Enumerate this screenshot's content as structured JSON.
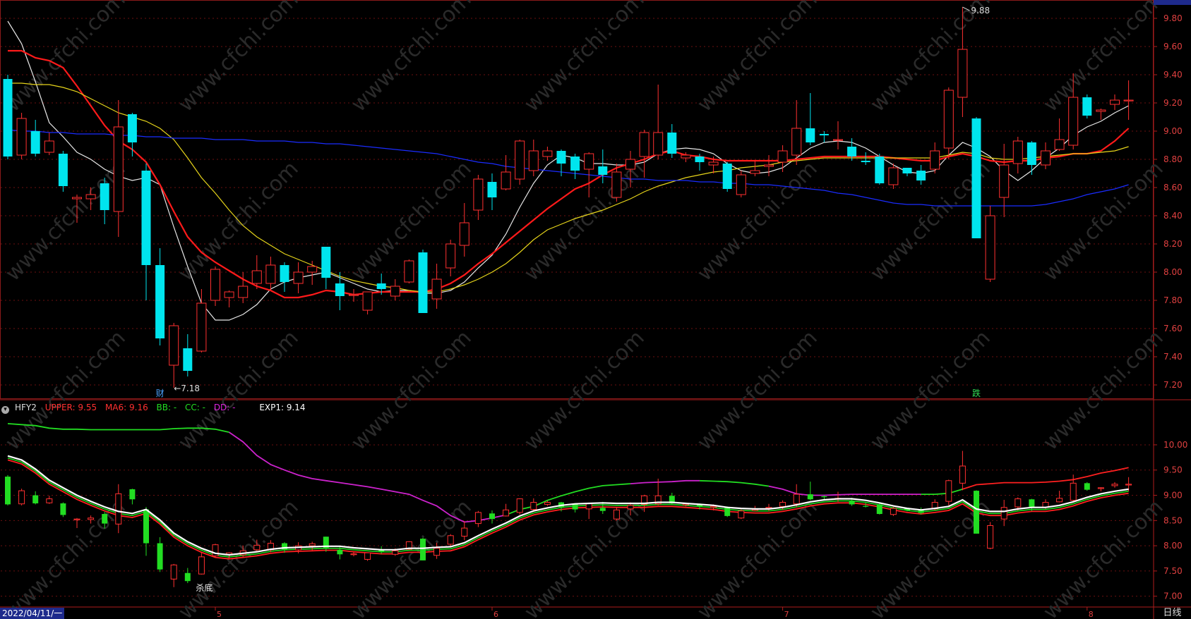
{
  "chart_data": {
    "type": "candlestick",
    "date_label": "2022/04/11/一",
    "period": "日线",
    "month_ticks": [
      "5",
      "6",
      "7",
      "8"
    ],
    "main": {
      "yticks": [
        "9.80",
        "9.60",
        "9.40",
        "9.20",
        "9.00",
        "8.80",
        "8.60",
        "8.40",
        "8.20",
        "8.00",
        "7.80",
        "7.60",
        "7.40",
        "7.20"
      ],
      "ylim": [
        7.1,
        9.9
      ],
      "high_annotation": "9.88",
      "low_annotation": "7.18",
      "markers": [
        {
          "text": "财",
          "color": "#4aa3ff"
        },
        {
          "text": "跌",
          "color": "#33dd55"
        }
      ],
      "candles": [
        [
          9.37,
          8.82,
          9.4,
          8.8
        ],
        [
          8.83,
          9.09,
          9.13,
          8.8
        ],
        [
          9.0,
          8.84,
          9.08,
          8.82
        ],
        [
          8.85,
          8.93,
          8.99,
          8.83
        ],
        [
          8.84,
          8.61,
          8.86,
          8.57
        ],
        [
          8.52,
          8.53,
          8.55,
          8.35
        ],
        [
          8.52,
          8.55,
          8.6,
          8.44
        ],
        [
          8.63,
          8.44,
          8.67,
          8.34
        ],
        [
          8.43,
          9.03,
          9.22,
          8.25
        ],
        [
          9.12,
          8.92,
          9.13,
          8.82
        ],
        [
          8.72,
          8.05,
          8.77,
          7.8
        ],
        [
          8.05,
          7.53,
          8.17,
          7.48
        ],
        [
          7.34,
          7.62,
          7.64,
          7.18
        ],
        [
          7.46,
          7.3,
          7.56,
          7.26
        ],
        [
          7.44,
          7.78,
          7.88,
          7.43
        ],
        [
          7.8,
          8.02,
          8.04,
          7.76
        ],
        [
          7.82,
          7.86,
          7.87,
          7.75
        ],
        [
          7.82,
          7.9,
          8.0,
          7.78
        ],
        [
          7.92,
          8.01,
          8.12,
          7.88
        ],
        [
          7.92,
          8.05,
          8.11,
          7.87
        ],
        [
          8.05,
          7.93,
          8.07,
          7.86
        ],
        [
          7.92,
          8.0,
          8.07,
          7.85
        ],
        [
          8.0,
          8.04,
          8.08,
          7.91
        ],
        [
          8.18,
          7.96,
          8.18,
          7.88
        ],
        [
          7.92,
          7.83,
          8.0,
          7.73
        ],
        [
          7.84,
          7.84,
          7.88,
          7.79
        ],
        [
          7.73,
          7.86,
          7.86,
          7.7
        ],
        [
          7.92,
          7.88,
          7.99,
          7.84
        ],
        [
          7.83,
          7.9,
          7.95,
          7.8
        ],
        [
          7.93,
          8.08,
          8.09,
          7.92
        ],
        [
          8.14,
          7.71,
          8.16,
          7.71
        ],
        [
          7.81,
          7.95,
          8.06,
          7.74
        ],
        [
          8.03,
          8.2,
          8.23,
          7.97
        ],
        [
          8.19,
          8.35,
          8.49,
          8.11
        ],
        [
          8.44,
          8.66,
          8.69,
          8.37
        ],
        [
          8.64,
          8.53,
          8.7,
          8.44
        ],
        [
          8.59,
          8.71,
          8.83,
          8.58
        ],
        [
          8.66,
          8.93,
          8.94,
          8.62
        ],
        [
          8.72,
          8.86,
          8.94,
          8.68
        ],
        [
          8.82,
          8.86,
          8.89,
          8.79
        ],
        [
          8.86,
          8.77,
          8.87,
          8.68
        ],
        [
          8.82,
          8.72,
          8.84,
          8.66
        ],
        [
          8.73,
          8.84,
          8.85,
          8.53
        ],
        [
          8.75,
          8.69,
          8.87,
          8.63
        ],
        [
          8.53,
          8.71,
          8.77,
          8.5
        ],
        [
          8.73,
          8.8,
          8.86,
          8.6
        ],
        [
          8.82,
          8.99,
          9.01,
          8.67
        ],
        [
          8.83,
          8.99,
          9.33,
          8.8
        ],
        [
          8.99,
          8.84,
          9.05,
          8.81
        ],
        [
          8.81,
          8.83,
          8.85,
          8.78
        ],
        [
          8.82,
          8.78,
          8.84,
          8.72
        ],
        [
          8.76,
          8.78,
          8.82,
          8.7
        ],
        [
          8.77,
          8.59,
          8.78,
          8.57
        ],
        [
          8.55,
          8.69,
          8.72,
          8.53
        ],
        [
          8.7,
          8.72,
          8.79,
          8.68
        ],
        [
          8.75,
          8.76,
          8.83,
          8.68
        ],
        [
          8.78,
          8.86,
          8.9,
          8.71
        ],
        [
          8.83,
          9.02,
          9.22,
          8.76
        ],
        [
          9.02,
          8.92,
          9.27,
          8.9
        ],
        [
          8.98,
          8.97,
          9.0,
          8.92
        ],
        [
          8.94,
          8.94,
          9.07,
          8.87
        ],
        [
          8.89,
          8.82,
          8.95,
          8.79
        ],
        [
          8.79,
          8.78,
          8.85,
          8.76
        ],
        [
          8.82,
          8.63,
          8.84,
          8.62
        ],
        [
          8.62,
          8.74,
          8.77,
          8.59
        ],
        [
          8.74,
          8.7,
          8.72,
          8.68
        ],
        [
          8.72,
          8.65,
          8.76,
          8.62
        ],
        [
          8.73,
          8.86,
          8.92,
          8.7
        ],
        [
          8.88,
          9.29,
          9.31,
          8.8
        ],
        [
          9.24,
          9.58,
          9.88,
          9.1
        ],
        [
          9.09,
          8.24,
          9.1,
          8.24
        ],
        [
          7.95,
          8.4,
          8.47,
          7.93
        ],
        [
          8.53,
          8.76,
          8.91,
          8.39
        ],
        [
          8.77,
          8.93,
          8.96,
          8.7
        ],
        [
          8.92,
          8.76,
          8.93,
          8.69
        ],
        [
          8.76,
          8.86,
          8.92,
          8.73
        ],
        [
          8.87,
          8.94,
          9.09,
          8.86
        ],
        [
          8.9,
          9.24,
          9.41,
          8.87
        ],
        [
          9.24,
          9.11,
          9.26,
          9.09
        ],
        [
          9.14,
          9.15,
          9.16,
          9.08
        ],
        [
          9.19,
          9.22,
          9.26,
          9.15
        ],
        [
          9.22,
          9.22,
          9.36,
          9.08
        ]
      ],
      "ma_series": [
        {
          "color": "#e8e8e8",
          "values": [
            9.78,
            9.62,
            9.35,
            9.06,
            8.96,
            8.85,
            8.8,
            8.73,
            8.68,
            8.65,
            8.67,
            8.62,
            8.32,
            8.04,
            7.78,
            7.66,
            7.66,
            7.7,
            7.77,
            7.88,
            7.93,
            7.96,
            7.98,
            8.0,
            7.96,
            7.92,
            7.88,
            7.86,
            7.87,
            7.87,
            7.85,
            7.85,
            7.87,
            7.93,
            8.03,
            8.12,
            8.27,
            8.46,
            8.63,
            8.76,
            8.83,
            8.81,
            8.77,
            8.77,
            8.76,
            8.76,
            8.78,
            8.84,
            8.87,
            8.88,
            8.87,
            8.84,
            8.77,
            8.72,
            8.7,
            8.71,
            8.74,
            8.81,
            8.88,
            8.92,
            8.93,
            8.92,
            8.88,
            8.82,
            8.76,
            8.71,
            8.7,
            8.72,
            8.83,
            8.92,
            8.88,
            8.82,
            8.72,
            8.65,
            8.72,
            8.81,
            8.88,
            8.97,
            9.03,
            9.07,
            9.13,
            9.18
          ]
        },
        {
          "color": "#ff1a1a",
          "values": [
            9.57,
            9.57,
            9.52,
            9.5,
            9.45,
            9.32,
            9.18,
            9.04,
            8.93,
            8.87,
            8.78,
            8.62,
            8.43,
            8.25,
            8.14,
            8.07,
            8.01,
            7.95,
            7.9,
            7.87,
            7.82,
            7.82,
            7.84,
            7.87,
            7.86,
            7.84,
            7.85,
            7.86,
            7.86,
            7.86,
            7.86,
            7.88,
            7.92,
            7.98,
            8.06,
            8.13,
            8.21,
            8.29,
            8.37,
            8.45,
            8.52,
            8.59,
            8.63,
            8.69,
            8.74,
            8.77,
            8.8,
            8.84,
            8.86,
            8.83,
            8.82,
            8.8,
            8.79,
            8.79,
            8.79,
            8.79,
            8.79,
            8.8,
            8.81,
            8.82,
            8.82,
            8.82,
            8.82,
            8.82,
            8.81,
            8.8,
            8.79,
            8.79,
            8.82,
            8.84,
            8.82,
            8.79,
            8.78,
            8.79,
            8.79,
            8.81,
            8.82,
            8.84,
            8.84,
            8.86,
            8.93,
            9.02
          ]
        },
        {
          "color": "#e6d41a",
          "values": [
            9.34,
            9.34,
            9.33,
            9.33,
            9.31,
            9.28,
            9.23,
            9.18,
            9.13,
            9.1,
            9.07,
            9.02,
            8.94,
            8.81,
            8.67,
            8.56,
            8.44,
            8.33,
            8.25,
            8.19,
            8.13,
            8.09,
            8.05,
            8.01,
            7.97,
            7.94,
            7.92,
            7.9,
            7.89,
            7.87,
            7.86,
            7.86,
            7.88,
            7.91,
            7.95,
            8.0,
            8.06,
            8.14,
            8.23,
            8.3,
            8.34,
            8.38,
            8.41,
            8.44,
            8.48,
            8.52,
            8.57,
            8.61,
            8.64,
            8.67,
            8.69,
            8.71,
            8.72,
            8.74,
            8.75,
            8.76,
            8.78,
            8.79,
            8.8,
            8.81,
            8.81,
            8.81,
            8.81,
            8.81,
            8.81,
            8.81,
            8.81,
            8.81,
            8.83,
            8.85,
            8.84,
            8.81,
            8.8,
            8.8,
            8.81,
            8.82,
            8.83,
            8.84,
            8.84,
            8.85,
            8.86,
            8.89
          ]
        },
        {
          "color": "#1a2cff",
          "values": [
            9.01,
            9.0,
            9.0,
            8.99,
            8.99,
            8.98,
            8.98,
            8.98,
            8.97,
            8.97,
            8.96,
            8.96,
            8.95,
            8.95,
            8.95,
            8.94,
            8.94,
            8.94,
            8.93,
            8.93,
            8.93,
            8.92,
            8.92,
            8.91,
            8.91,
            8.9,
            8.89,
            8.88,
            8.87,
            8.86,
            8.85,
            8.84,
            8.82,
            8.8,
            8.78,
            8.77,
            8.75,
            8.74,
            8.73,
            8.72,
            8.71,
            8.7,
            8.69,
            8.68,
            8.67,
            8.66,
            8.66,
            8.65,
            8.65,
            8.65,
            8.64,
            8.64,
            8.63,
            8.63,
            8.62,
            8.62,
            8.61,
            8.6,
            8.59,
            8.58,
            8.56,
            8.55,
            8.53,
            8.51,
            8.49,
            8.48,
            8.48,
            8.47,
            8.47,
            8.47,
            8.47,
            8.47,
            8.47,
            8.47,
            8.47,
            8.48,
            8.5,
            8.52,
            8.55,
            8.57,
            8.59,
            8.62
          ]
        }
      ]
    },
    "sub": {
      "name": "HFY2",
      "upper_label": "UPPER: 9.55",
      "ma6_label": "MA6: 9.16",
      "bb_label": "BB: -",
      "cc_label": "CC: -",
      "dd_label": "DD: -",
      "exp1_label": "EXP1: 9.14",
      "yticks": [
        "10.00",
        "9.50",
        "9.00",
        "8.50",
        "8.00",
        "7.50",
        "7.00"
      ],
      "ylim": [
        6.8,
        10.6
      ],
      "marker": "杀底",
      "upper_values": [
        10.42,
        10.4,
        10.38,
        10.33,
        10.31,
        10.31,
        10.3,
        10.3,
        10.3,
        10.3,
        10.3,
        10.3,
        10.32,
        10.33,
        10.33,
        10.31,
        10.25,
        10.06,
        9.79,
        9.61,
        9.5,
        9.4,
        9.33,
        9.29,
        9.25,
        9.21,
        9.17,
        9.12,
        9.07,
        9.02,
        8.9,
        8.79,
        8.6,
        8.47,
        8.5,
        8.55,
        8.61,
        8.72,
        8.78,
        8.9,
        8.99,
        9.07,
        9.14,
        9.19,
        9.21,
        9.23,
        9.25,
        9.26,
        9.27,
        9.29,
        9.29,
        9.28,
        9.27,
        9.25,
        9.22,
        9.18,
        9.12,
        9.03,
        9.0,
        9.0,
        9.01,
        9.02,
        9.02,
        9.02,
        9.02,
        9.02,
        9.02,
        9.02,
        9.04,
        9.12,
        9.21,
        9.23,
        9.25,
        9.25,
        9.25,
        9.26,
        9.28,
        9.31,
        9.37,
        9.44,
        9.49,
        9.55
      ],
      "upper_seg_colors": [
        "#22dd22",
        "#cc22cc",
        "#22dd22",
        "#cc22cc",
        "#22dd22",
        "#cc22cc",
        "#22dd22",
        "#ff2020"
      ],
      "upper_seg_breaks": [
        16,
        36,
        45,
        50,
        55,
        66,
        69
      ],
      "lower_values": [
        9.78,
        9.7,
        9.52,
        9.3,
        9.15,
        9.0,
        8.88,
        8.77,
        8.68,
        8.64,
        8.72,
        8.51,
        8.25,
        8.08,
        7.95,
        7.85,
        7.82,
        7.85,
        7.88,
        7.93,
        7.96,
        7.97,
        7.98,
        7.99,
        7.99,
        7.96,
        7.94,
        7.92,
        7.92,
        7.95,
        7.95,
        7.97,
        7.98,
        8.06,
        8.2,
        8.33,
        8.45,
        8.59,
        8.69,
        8.75,
        8.8,
        8.83,
        8.84,
        8.85,
        8.84,
        8.84,
        8.84,
        8.86,
        8.86,
        8.84,
        8.82,
        8.8,
        8.76,
        8.74,
        8.73,
        8.73,
        8.76,
        8.81,
        8.87,
        8.91,
        8.93,
        8.93,
        8.9,
        8.85,
        8.79,
        8.74,
        8.71,
        8.74,
        8.78,
        8.91,
        8.73,
        8.68,
        8.68,
        8.73,
        8.76,
        8.76,
        8.8,
        8.87,
        8.96,
        9.03,
        9.08,
        9.12
      ]
    }
  }
}
